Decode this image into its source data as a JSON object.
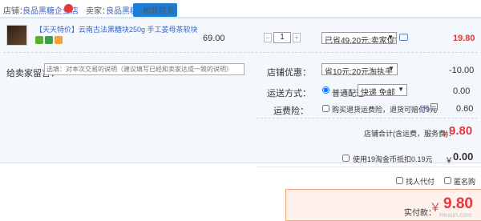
{
  "header": {
    "shop_label": "店铺：",
    "shop_name": "良品黑糖企业店",
    "seller_label": "卖家：",
    "seller_name": "良品黑糖",
    "contact": "和我联系"
  },
  "item": {
    "title": "【天天特价】云南古法黑糖块250g 手工姜母茶软块",
    "price": "69.00",
    "quantity": "1",
    "discount_select": "已省49.20元:卖家促销",
    "subtotal": "19.80"
  },
  "message": {
    "label": "给卖家留言：",
    "placeholder": "选填：对本次交易的说明（建议填写已经和卖家达成一致的说明）"
  },
  "shop_discount": {
    "label": "店铺优惠：",
    "select": "省10元:20元淘执手",
    "value": "-10.00"
  },
  "shipping": {
    "label": "运送方式：",
    "radio": "普通配送",
    "select": "快递 免邮",
    "value": "0.00"
  },
  "insurance": {
    "label": "运费险：",
    "checkbox": "购买退货运费险，退货可赔付9元",
    "help": "[?]",
    "value": "0.60"
  },
  "shop_total": {
    "label": "店铺合计(含运费，服务费)：",
    "currency": "￥",
    "value": "9.80"
  },
  "coins": {
    "checkbox": "使用19淘金币抵扣0.19元",
    "currency": "￥",
    "value": "0.00"
  },
  "options": {
    "proxy": "找人代付",
    "anonymous": "匿名购买"
  },
  "payment": {
    "label": "实付款：",
    "currency": "￥",
    "value": "9.80"
  },
  "watermark": "Hexun.com"
}
